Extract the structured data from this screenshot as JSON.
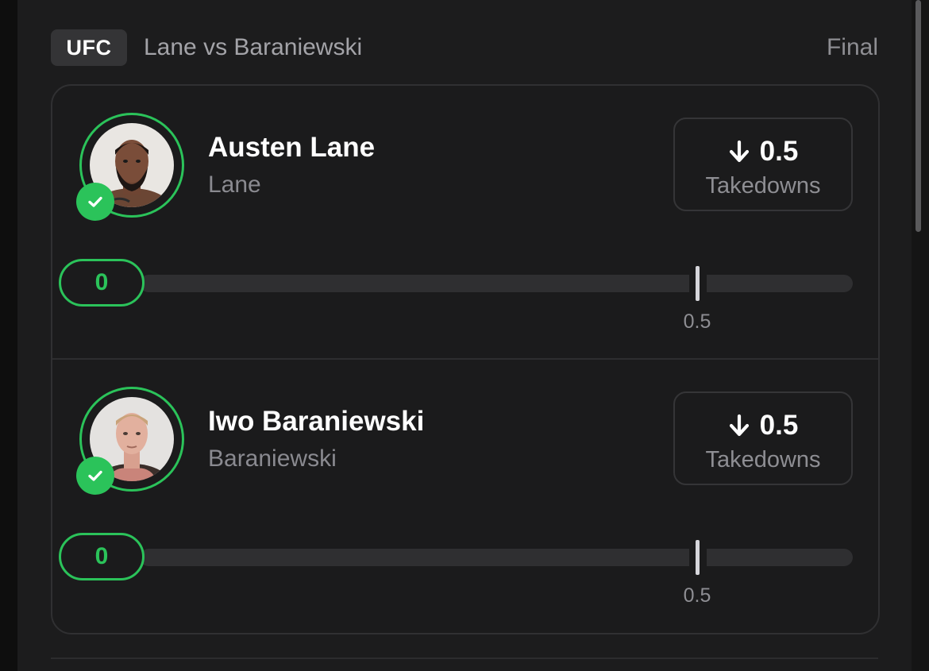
{
  "header": {
    "league": "UFC",
    "match_title": "Lane vs Baraniewski",
    "status": "Final"
  },
  "players": [
    {
      "name": "Austen Lane",
      "team": "Lane",
      "line": "0.5",
      "stat_type": "Takedowns",
      "direction_icon": "arrow-down-icon",
      "current_value": "0",
      "threshold_label": "0.5",
      "progress": 0
    },
    {
      "name": "Iwo Baraniewski",
      "team": "Baraniewski",
      "line": "0.5",
      "stat_type": "Takedowns",
      "direction_icon": "arrow-down-icon",
      "current_value": "0",
      "threshold_label": "0.5",
      "progress": 0
    }
  ],
  "colors": {
    "accent_green": "#2bc35a",
    "background": "#1c1c1d"
  }
}
